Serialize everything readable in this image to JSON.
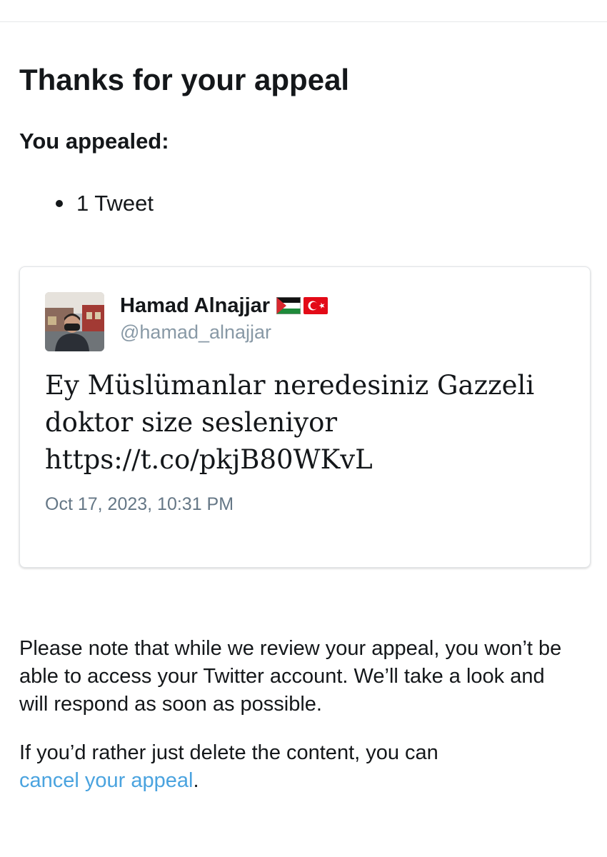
{
  "header": {
    "title": "Thanks for your appeal"
  },
  "appeal": {
    "heading": "You appealed:",
    "items": [
      "1 Tweet"
    ]
  },
  "tweet": {
    "author_name": "Hamad Alnajjar",
    "flags": [
      "palestine-flag",
      "turkey-flag"
    ],
    "handle": "@hamad_alnajjar",
    "text_lines": [
      "Ey Müslümanlar neredesiniz Gazzeli",
      "doktor size sesleniyor",
      "https://t.co/pkjB80WKvL"
    ],
    "timestamp": "Oct 17, 2023, 10:31 PM"
  },
  "notice": {
    "lines": [
      "Please note that while we review your appeal, you won’t be",
      "able to access your Twitter account. We’ll take a look and",
      "will respond as soon as possible."
    ]
  },
  "delete_notice": {
    "line1": "If you’d rather just delete the content, you can",
    "link_text": "cancel your appeal",
    "suffix": "."
  },
  "colors": {
    "text": "#14171a",
    "secondary": "#8899a6",
    "timestamp": "#657786",
    "link": "#4aa3df",
    "border": "#e1e4e7"
  }
}
